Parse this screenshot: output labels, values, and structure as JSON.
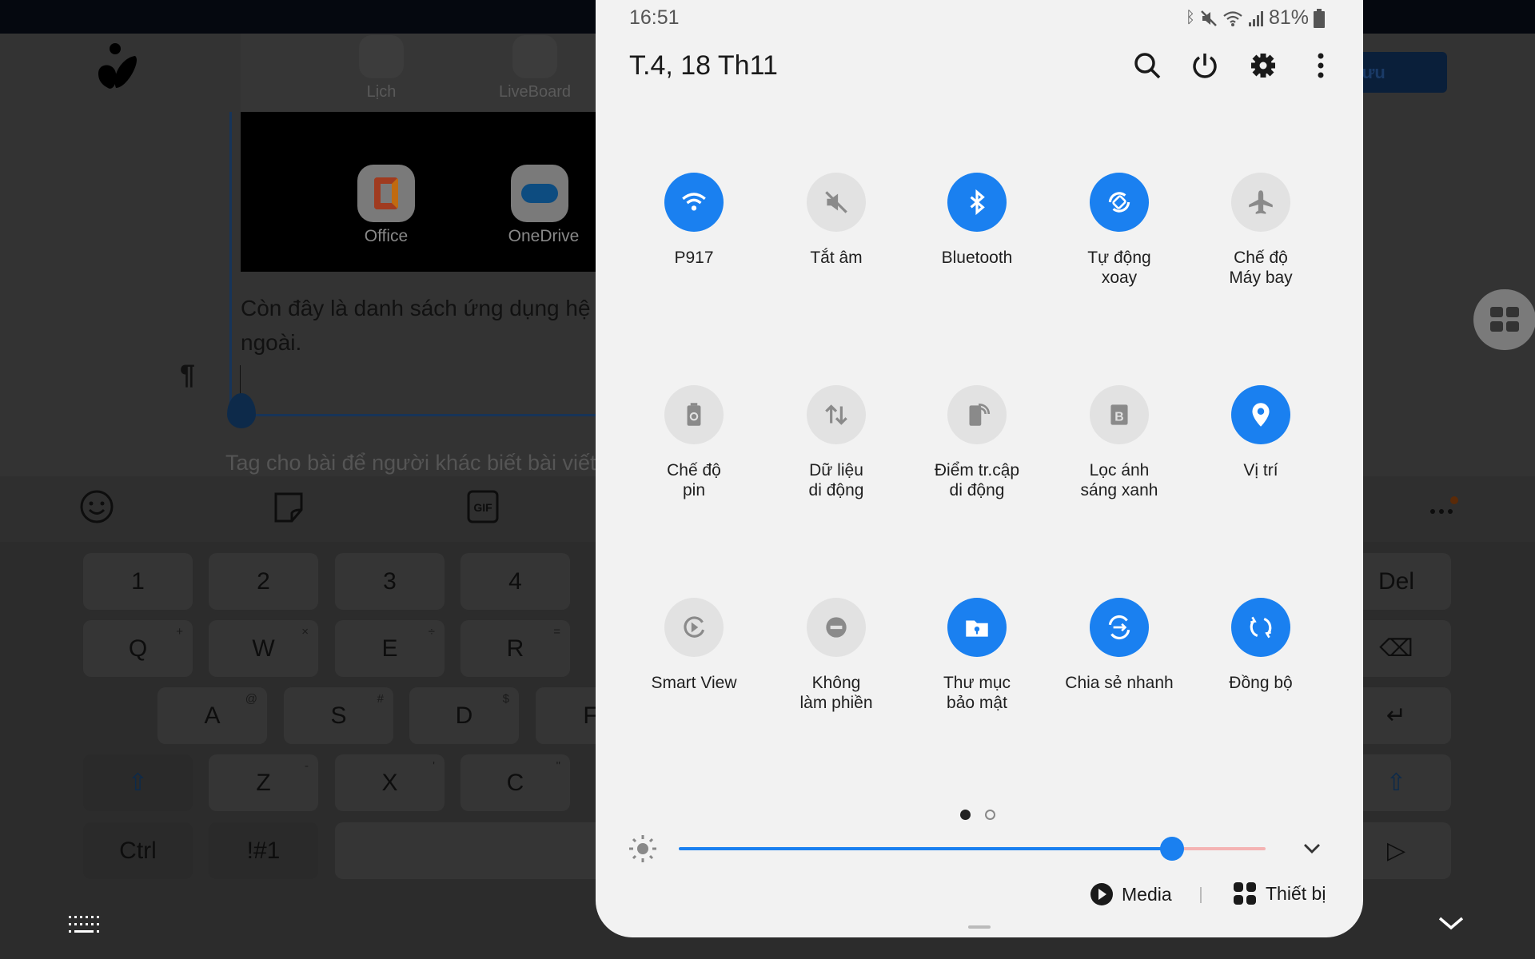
{
  "status_bar": {
    "time": "16:51",
    "battery": "81%",
    "icons": [
      "bluetooth-icon",
      "mute-icon",
      "wifi-icon",
      "signal-icon",
      "battery-icon"
    ]
  },
  "panel": {
    "date": "T.4, 18 Th11",
    "header_icons": [
      "search-icon",
      "power-icon",
      "gear-icon",
      "more-vert-icon"
    ],
    "tiles": [
      {
        "label": "P917",
        "icon": "wifi-icon",
        "active": true
      },
      {
        "label": "Tắt âm",
        "icon": "mute-icon",
        "active": false
      },
      {
        "label": "Bluetooth",
        "icon": "bluetooth-icon",
        "active": true
      },
      {
        "label": "Tự động\nxoay",
        "icon": "auto-rotate-icon",
        "active": true
      },
      {
        "label": "Chế độ\nMáy bay",
        "icon": "airplane-icon",
        "active": false
      },
      {
        "label": "Chế độ\npin",
        "icon": "battery-saver-icon",
        "active": false
      },
      {
        "label": "Dữ liệu\ndi động",
        "icon": "mobile-data-icon",
        "active": false
      },
      {
        "label": "Điểm tr.cập\ndi động",
        "icon": "hotspot-icon",
        "active": false
      },
      {
        "label": "Lọc ánh\nsáng xanh",
        "icon": "blue-light-filter-icon",
        "active": false
      },
      {
        "label": "Vị trí",
        "icon": "location-icon",
        "active": true
      },
      {
        "label": "Smart View",
        "icon": "smart-view-icon",
        "active": false
      },
      {
        "label": "Không\nlàm phiền",
        "icon": "do-not-disturb-icon",
        "active": false
      },
      {
        "label": "Thư mục\nbảo mật",
        "icon": "secure-folder-icon",
        "active": true
      },
      {
        "label": "Chia sẻ nhanh",
        "icon": "quick-share-icon",
        "active": true
      },
      {
        "label": "Đồng bộ",
        "icon": "sync-icon",
        "active": true
      }
    ],
    "page_indicator": {
      "current": 1,
      "total": 2
    },
    "brightness": {
      "value": 0.84
    },
    "media_label": "Media",
    "devices_label": "Thiết bị",
    "accent": "#1a80f0"
  },
  "background": {
    "save_button": "Lưu",
    "apps": [
      "Lịch",
      "LiveBoard",
      "Office",
      "OneDrive"
    ],
    "paragraph": "Còn đây là danh sách ứng dụng hệ\nngoài.",
    "pilcrow": "¶",
    "tag_placeholder": "Tag cho bài để người khác biết bài viết"
  },
  "keyboard": {
    "rows": [
      [
        {
          "k": "1"
        },
        {
          "k": "2"
        },
        {
          "k": "3"
        },
        {
          "k": "4"
        }
      ],
      [
        {
          "k": "Q",
          "s": "+"
        },
        {
          "k": "W",
          "s": "×"
        },
        {
          "k": "E",
          "s": "÷"
        },
        {
          "k": "R",
          "s": "="
        }
      ],
      [
        {
          "k": "A",
          "s": "@"
        },
        {
          "k": "S",
          "s": "#"
        },
        {
          "k": "D",
          "s": "$"
        },
        {
          "k": "F"
        }
      ],
      [
        {
          "k": "⇧"
        },
        {
          "k": "Z",
          "s": "-"
        },
        {
          "k": "X",
          "s": "'"
        },
        {
          "k": "C",
          "s": "\""
        }
      ],
      [
        {
          "k": "Ctrl"
        },
        {
          "k": "!#1"
        },
        {
          "k": ""
        }
      ]
    ],
    "right_keys": [
      "Del",
      "⌫",
      "↵",
      "⇧",
      "▷"
    ]
  }
}
